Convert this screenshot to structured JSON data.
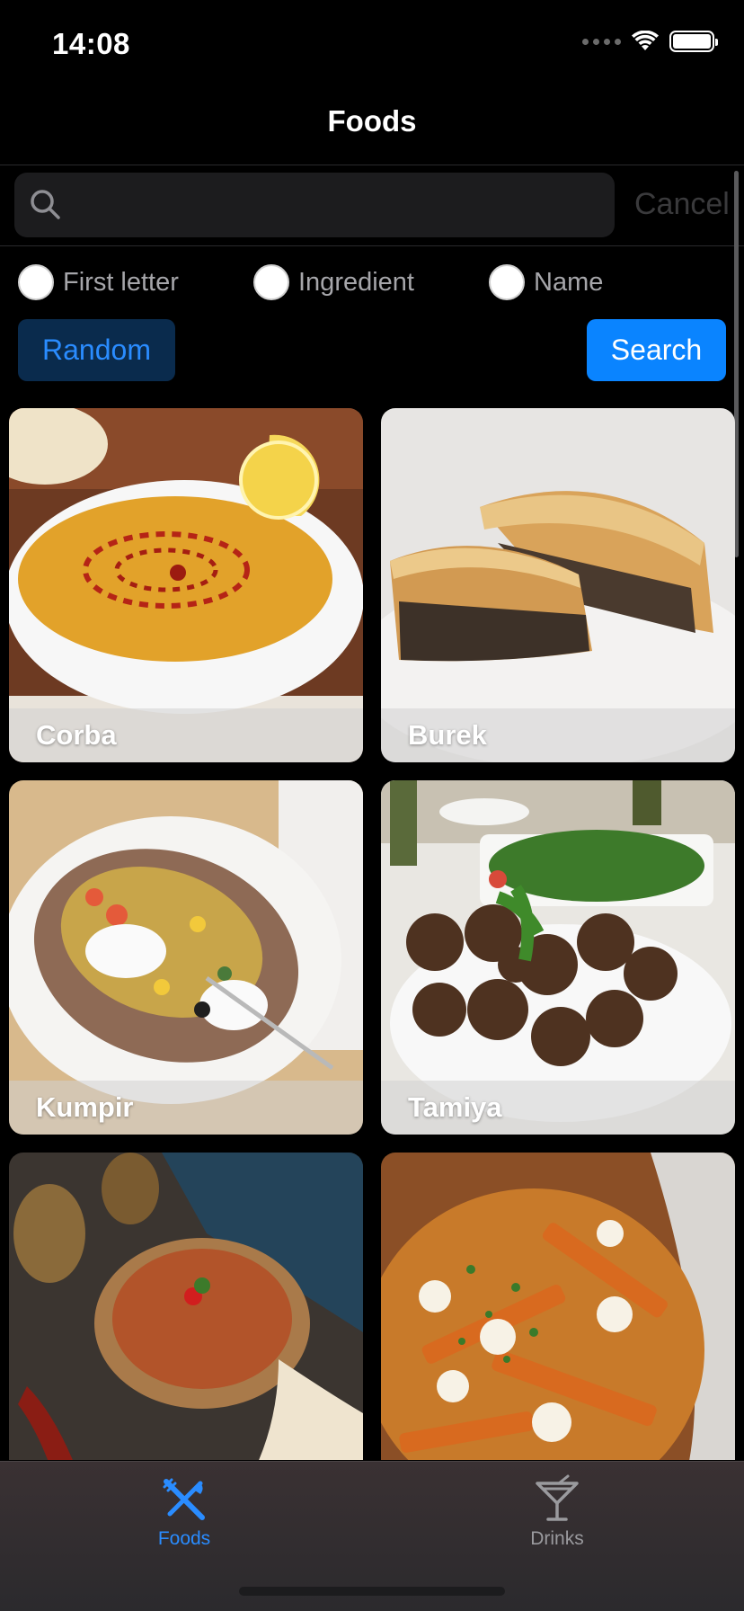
{
  "status_bar": {
    "time": "14:08"
  },
  "nav": {
    "title": "Foods"
  },
  "search": {
    "placeholder": "",
    "value": "",
    "cancel_label": "Cancel"
  },
  "filters": {
    "options": [
      {
        "label": "First letter",
        "selected": false
      },
      {
        "label": "Ingredient",
        "selected": false
      },
      {
        "label": "Name",
        "selected": false
      }
    ]
  },
  "actions": {
    "random_label": "Random",
    "search_label": "Search"
  },
  "foods": [
    {
      "name": "Corba",
      "image": "lentil-soup-photo"
    },
    {
      "name": "Burek",
      "image": "meat-pastry-photo"
    },
    {
      "name": "Kumpir",
      "image": "stuffed-potato-photo"
    },
    {
      "name": "Tamiya",
      "image": "falafel-photo"
    },
    {
      "name": "",
      "image": "soup-in-copper-bowl-photo"
    },
    {
      "name": "",
      "image": "poutine-photo"
    }
  ],
  "tab_bar": {
    "tabs": [
      {
        "label": "Foods",
        "icon": "fork-knife-icon",
        "active": true
      },
      {
        "label": "Drinks",
        "icon": "cocktail-glass-icon",
        "active": false
      }
    ]
  },
  "colors": {
    "accent": "#0A84FF",
    "background": "#000000"
  }
}
